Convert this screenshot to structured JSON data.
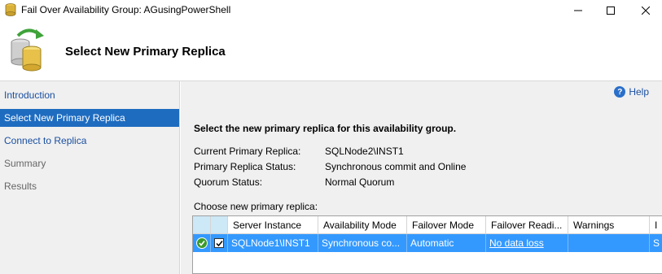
{
  "window": {
    "title": "Fail Over Availability Group: AGusingPowerShell"
  },
  "header": {
    "title": "Select New Primary Replica"
  },
  "sidebar": {
    "items": [
      {
        "label": "Introduction",
        "state": "link"
      },
      {
        "label": "Select New Primary Replica",
        "state": "selected"
      },
      {
        "label": "Connect to Replica",
        "state": "link"
      },
      {
        "label": "Summary",
        "state": "disabled"
      },
      {
        "label": "Results",
        "state": "disabled"
      }
    ]
  },
  "main": {
    "help_label": "Help",
    "instruction": "Select the new primary replica for this availability group.",
    "info": [
      {
        "label": "Current Primary Replica:",
        "value": "SQLNode2\\INST1"
      },
      {
        "label": "Primary Replica Status:",
        "value": "Synchronous commit and Online"
      },
      {
        "label": "Quorum Status:",
        "value": "Normal Quorum"
      }
    ],
    "choose_label": "Choose new primary replica:",
    "grid": {
      "columns": [
        "",
        "",
        "Server Instance",
        "Availability Mode",
        "Failover Mode",
        "Failover Readi...",
        "Warnings",
        "I"
      ],
      "rows": [
        {
          "status_icon": "success-check-icon",
          "checked": true,
          "server_instance": "SQLNode1\\INST1",
          "availability_mode": "Synchronous co...",
          "failover_mode": "Automatic",
          "failover_readiness": "No data loss",
          "warnings": "",
          "extra": "S"
        }
      ]
    }
  },
  "colors": {
    "selected_nav": "#1e6cc0",
    "selected_row": "#3399ff",
    "link": "#1a4fa0",
    "panel_bg": "#f0f0f0"
  }
}
